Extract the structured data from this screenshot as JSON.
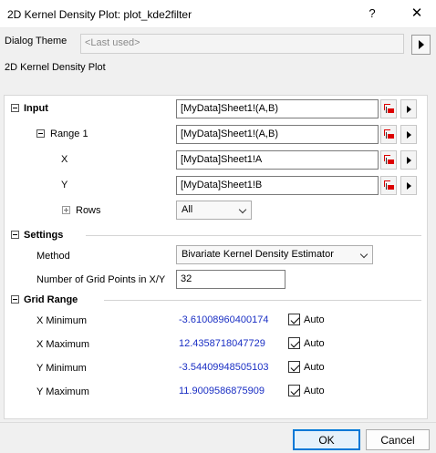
{
  "window": {
    "title": "2D Kernel Density Plot: plot_kde2filter",
    "help_glyph": "?",
    "close_glyph": "✕"
  },
  "theme": {
    "label": "Dialog Theme",
    "placeholder": "<Last used>"
  },
  "description": "2D Kernel Density Plot",
  "input": {
    "heading": "Input",
    "value": "[MyData]Sheet1!(A,B)",
    "range1": {
      "label": "Range 1",
      "value": "[MyData]Sheet1!(A,B)",
      "x_label": "X",
      "x_value": "[MyData]Sheet1!A",
      "y_label": "Y",
      "y_value": "[MyData]Sheet1!B",
      "rows_label": "Rows",
      "rows_value": "All"
    }
  },
  "settings": {
    "heading": "Settings",
    "method_label": "Method",
    "method_value": "Bivariate Kernel Density Estimator",
    "grid_points_label": "Number of Grid Points in X/Y",
    "grid_points_value": "32"
  },
  "grid_range": {
    "heading": "Grid Range",
    "rows": [
      {
        "label": "X Minimum",
        "value": "-3.61008960400174",
        "auto": "Auto"
      },
      {
        "label": "X Maximum",
        "value": "12.4358718047729",
        "auto": "Auto"
      },
      {
        "label": "Y Minimum",
        "value": "-3.54409948505103",
        "auto": "Auto"
      },
      {
        "label": "Y Maximum",
        "value": "11.9009586875909",
        "auto": "Auto"
      }
    ]
  },
  "buttons": {
    "ok": "OK",
    "cancel": "Cancel"
  },
  "colors": {
    "value_blue": "#1a2fc4",
    "range_icon_red": "#dd0000",
    "ok_border": "#0078d7"
  }
}
